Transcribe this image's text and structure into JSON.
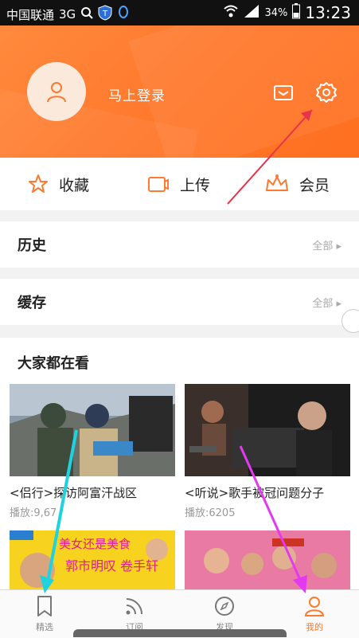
{
  "status_bar": {
    "carrier": "中国联通",
    "network": "3G",
    "battery": "34%",
    "time": "13:23"
  },
  "header": {
    "login_text": "马上登录"
  },
  "quick_actions": [
    {
      "label": "收藏",
      "icon": "star-icon"
    },
    {
      "label": "上传",
      "icon": "upload-icon"
    },
    {
      "label": "会员",
      "icon": "crown-icon"
    }
  ],
  "sections": {
    "history": {
      "title": "历史",
      "more": "全部"
    },
    "cache": {
      "title": "缓存",
      "more": "全部"
    }
  },
  "popular": {
    "title": "大家都在看",
    "videos": [
      {
        "title": "<侣行>探访阿富汗战区",
        "plays": "播放:9,67"
      },
      {
        "title": "<听说>歌手被冠问题分子",
        "plays": "播放:6205"
      },
      {
        "title": "",
        "plays": "",
        "banner_text": "美女还是美食",
        "sub_text": "郭市明叹 卷手轩"
      },
      {
        "title": "",
        "plays": ""
      }
    ]
  },
  "tabs": [
    {
      "label": "精选",
      "icon": "bookmark-icon",
      "active": false
    },
    {
      "label": "订阅",
      "icon": "rss-icon",
      "active": false
    },
    {
      "label": "发现",
      "icon": "compass-icon",
      "active": false
    },
    {
      "label": "我的",
      "icon": "user-icon",
      "active": true
    }
  ],
  "colors": {
    "accent": "#ff7a2e",
    "annotation_red": "#e8334a",
    "annotation_cyan": "#1fd2e0",
    "annotation_magenta": "#e33af0"
  }
}
